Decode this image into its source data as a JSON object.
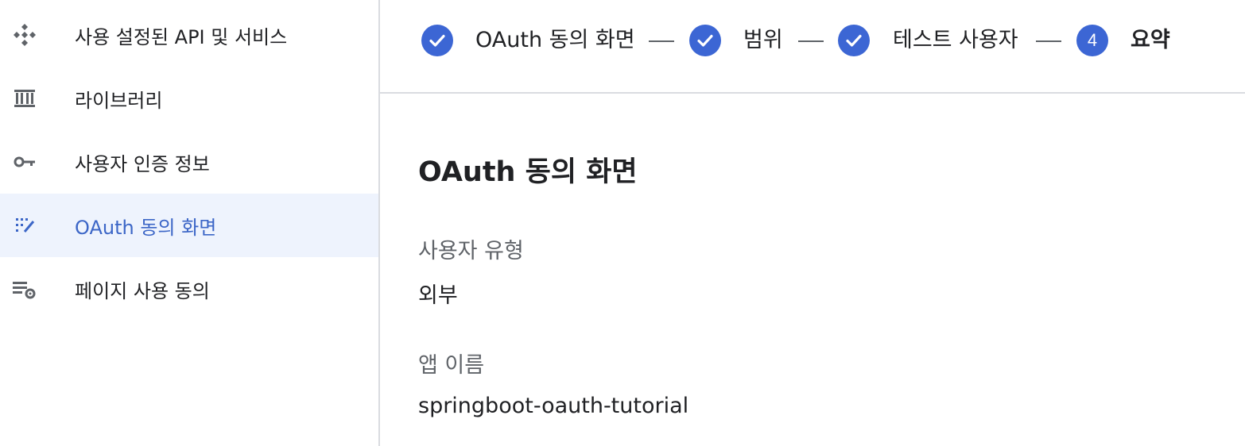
{
  "sidebar": {
    "items": [
      {
        "label": "사용 설정된 API 및 서비스",
        "icon": "api-services-icon"
      },
      {
        "label": "라이브러리",
        "icon": "library-icon"
      },
      {
        "label": "사용자 인증 정보",
        "icon": "key-icon"
      },
      {
        "label": "OAuth 동의 화면",
        "icon": "consent-screen-icon",
        "active": true
      },
      {
        "label": "페이지 사용 동의",
        "icon": "page-settings-icon"
      }
    ]
  },
  "stepper": {
    "steps": [
      {
        "label": "OAuth 동의 화면",
        "state": "done"
      },
      {
        "label": "범위",
        "state": "done"
      },
      {
        "label": "테스트 사용자",
        "state": "done"
      },
      {
        "label": "요약",
        "state": "current",
        "number": "4"
      }
    ]
  },
  "summary": {
    "title": "OAuth 동의 화면",
    "fields": [
      {
        "label": "사용자 유형",
        "value": "외부"
      },
      {
        "label": "앱 이름",
        "value": "springboot-oauth-tutorial"
      }
    ]
  },
  "colors": {
    "accent": "#3c66d4",
    "active_bg": "#eef3fd",
    "active_text": "#3c66c7"
  }
}
